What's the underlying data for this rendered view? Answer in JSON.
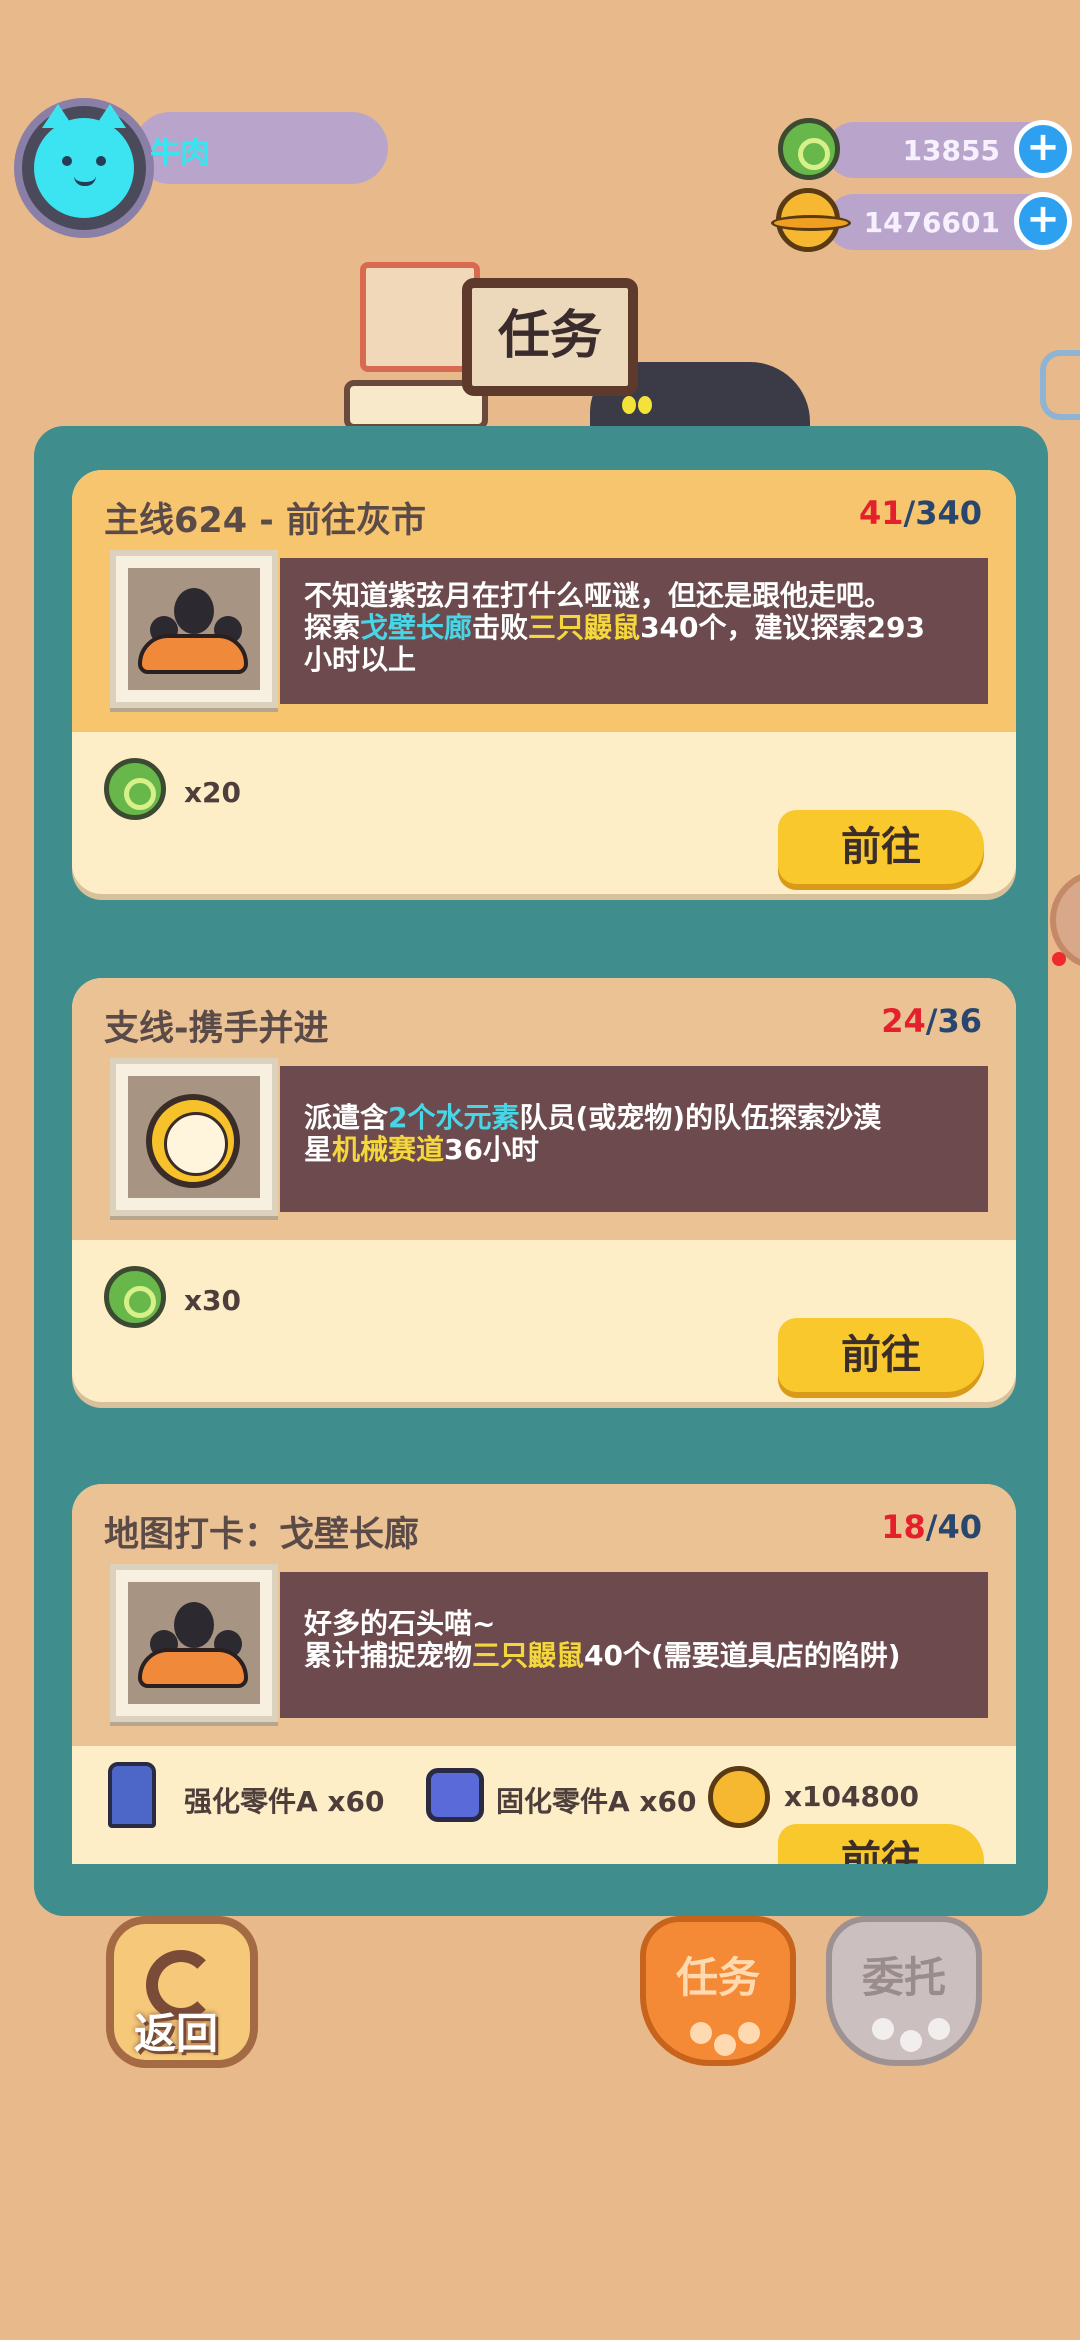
{
  "player": {
    "name": "牛肉"
  },
  "resources": {
    "gems": "13855",
    "coins": "1476601",
    "plus_symbol": "+"
  },
  "header": {
    "title": "任务"
  },
  "quests": [
    {
      "title": "主线624 - 前往灰市",
      "progress_current": "41",
      "progress_total": "/340",
      "desc_line1": "不知道紫弦月在打什么哑谜，但还是跟他走吧。",
      "desc_pre": "探索",
      "desc_hl1": "戈壁长廊",
      "desc_mid": "击败",
      "desc_hl2": "三只鼹鼠",
      "desc_post": "340个，建议探索293",
      "desc_line3": "小时以上",
      "reward_amount": "x20",
      "go_label": "前往"
    },
    {
      "title": "支线-携手并进",
      "progress_current": "24",
      "progress_total": "/36",
      "desc_pre": "派遣含",
      "desc_hl1": "2个水元素",
      "desc_post": "队员(或宠物)的队伍探索沙漠",
      "desc_line2_pre": "星",
      "desc_hl2": "机械赛道",
      "desc_line2_post": "36小时",
      "reward_amount": "x30",
      "go_label": "前往"
    },
    {
      "title": "地图打卡：戈壁长廊",
      "progress_current": "18",
      "progress_total": "/40",
      "desc_line1": "好多的石头喵~",
      "desc_pre": "累计捕捉宠物",
      "desc_hl": "三只鼹鼠",
      "desc_post": "40个(需要道具店的陷阱)",
      "reward1": "强化零件A x60",
      "reward2": "固化零件A x60",
      "reward3": "x104800",
      "go_label": "前往"
    }
  ],
  "nav": {
    "back_label": "返回",
    "task_label": "任务",
    "entrust_label": "委托"
  },
  "colors": {
    "background": "#e8b98a",
    "panel": "#3f8d8c",
    "card": "#fdeec8",
    "button": "#f8c82c",
    "progress_current": "#e3202c",
    "progress_total": "#28466e"
  }
}
